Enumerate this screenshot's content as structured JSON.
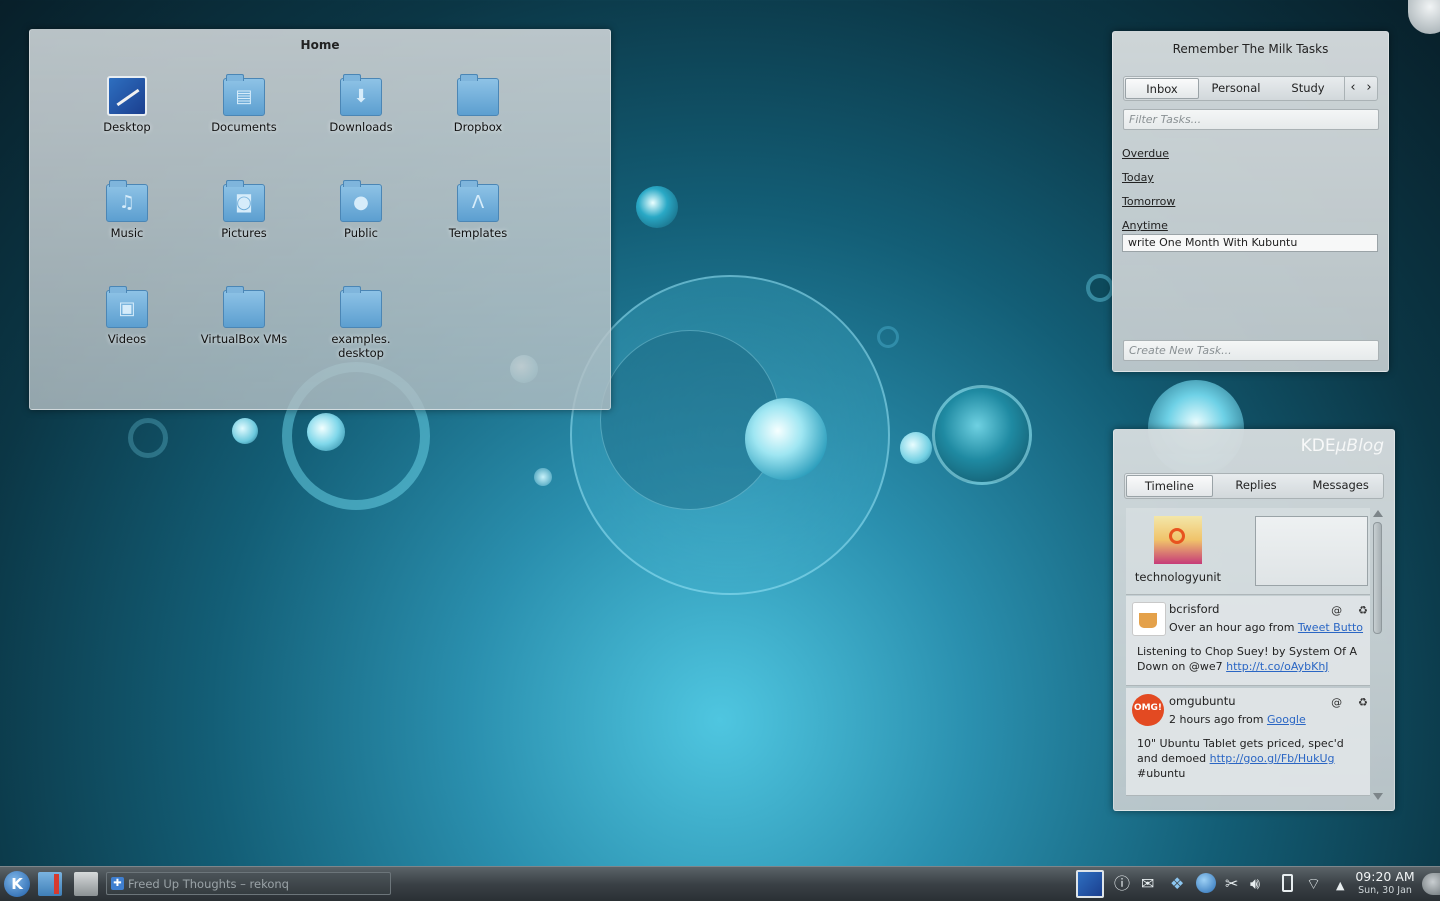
{
  "folder_view": {
    "title": "Home",
    "items": [
      {
        "label": "Desktop",
        "icon": "desktop-icon"
      },
      {
        "label": "Documents",
        "icon": "folder-documents-icon"
      },
      {
        "label": "Downloads",
        "icon": "folder-downloads-icon"
      },
      {
        "label": "Dropbox",
        "icon": "folder-icon"
      },
      {
        "label": "Music",
        "icon": "folder-music-icon"
      },
      {
        "label": "Pictures",
        "icon": "folder-pictures-icon"
      },
      {
        "label": "Public",
        "icon": "folder-public-icon"
      },
      {
        "label": "Templates",
        "icon": "folder-templates-icon"
      },
      {
        "label": "Videos",
        "icon": "folder-videos-icon"
      },
      {
        "label": "VirtualBox VMs",
        "icon": "folder-icon"
      },
      {
        "label": "examples.",
        "label2": "desktop",
        "icon": "folder-icon"
      }
    ]
  },
  "rtm": {
    "title": "Remember The Milk Tasks",
    "tabs": [
      "Inbox",
      "Personal",
      "Study"
    ],
    "filter_placeholder": "Filter Tasks...",
    "groups": [
      "Overdue",
      "Today",
      "Tomorrow",
      "Anytime"
    ],
    "task": "write One Month With Kubuntu",
    "create_placeholder": "Create New Task..."
  },
  "ublog": {
    "logo_kde": "KDE",
    "logo_rest": "µBlog",
    "tabs": [
      "Timeline",
      "Replies",
      "Messages"
    ],
    "user": "technologyunit",
    "posts": [
      {
        "name": "bcrisford",
        "meta_prefix": "Over an hour ago from ",
        "meta_link": "Tweet Butto",
        "text_line1": "Listening to Chop Suey! by System Of A",
        "text_line2_prefix": "Down on @we7 ",
        "text_link": "http://t.co/oAybKhJ"
      },
      {
        "name": "omgubuntu",
        "meta_prefix": "2 hours ago from ",
        "meta_link": "Google",
        "text_line1": "10\" Ubuntu Tablet gets priced, spec'd",
        "text_line2_prefix": "and demoed ",
        "text_link": "http://goo.gl/Fb/HukUg",
        "text_line3": "#ubuntu"
      }
    ],
    "reply_glyph": "@",
    "retweet_glyph": "♻"
  },
  "panel": {
    "task_title": "Freed Up Thoughts – rekonq",
    "time": "09:20 AM",
    "date": "Sun, 30 Jan"
  },
  "colors": {
    "wallpaper_center": "#4fc6e0",
    "wallpaper_edge": "#081f29",
    "link": "#2a66c4",
    "panel": "#3a4146"
  }
}
